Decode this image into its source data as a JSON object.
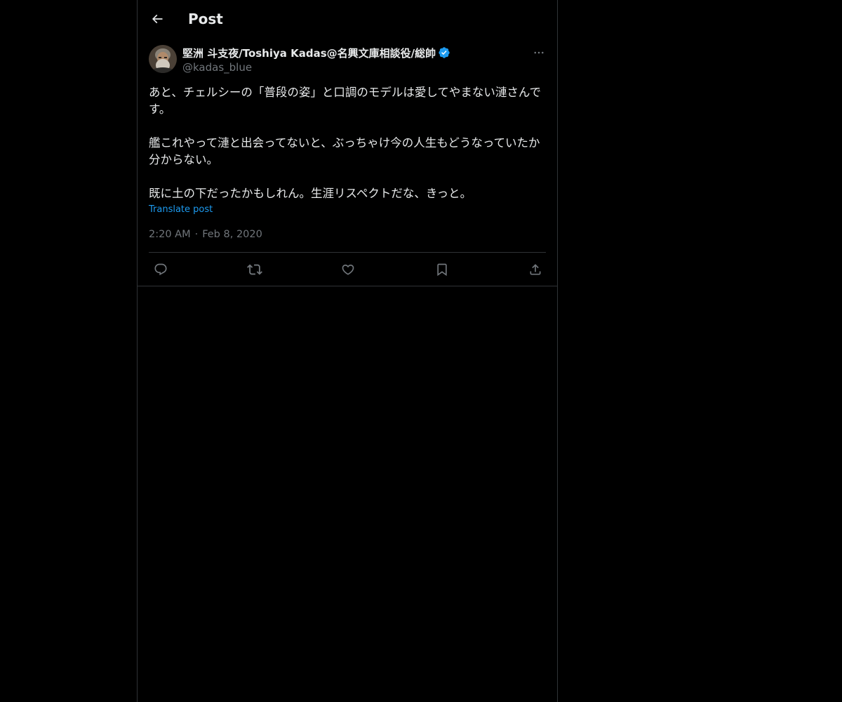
{
  "header": {
    "back_icon": "arrow-left-icon",
    "title": "Post"
  },
  "post": {
    "author": {
      "display_name": "堅洲 斗支夜/Toshiya Kadas@名興文庫相談役/総帥",
      "handle": "@kadas_blue",
      "verified": true,
      "verified_color": "#1d9bf0"
    },
    "text": "あと、チェルシーの「普段の姿」と口調のモデルは愛してやまない漣さんです。\n\n艦これやって漣と出会ってないと、ぶっちゃけ今の人生もどうなっていたか分からない。\n\n既に土の下だったかもしれん。生涯リスペクトだな、きっと。",
    "translate_label": "Translate post",
    "time": "2:20 AM",
    "separator": "·",
    "date": "Feb 8, 2020",
    "actions": [
      {
        "name": "reply",
        "icon": "reply-icon"
      },
      {
        "name": "repost",
        "icon": "repost-icon"
      },
      {
        "name": "like",
        "icon": "heart-icon"
      },
      {
        "name": "bookmark",
        "icon": "bookmark-icon"
      },
      {
        "name": "share",
        "icon": "share-icon"
      }
    ]
  },
  "colors": {
    "background": "#000000",
    "text": "#e7e9ea",
    "secondary": "#71767b",
    "accent": "#1d9bf0",
    "border": "#2f3336"
  }
}
